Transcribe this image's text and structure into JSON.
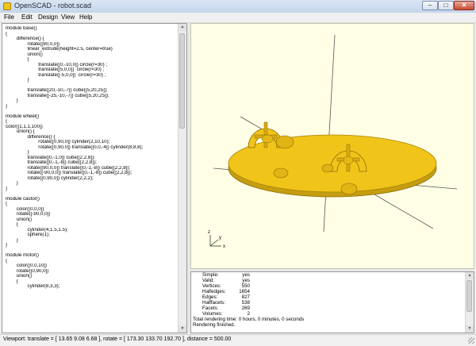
{
  "window": {
    "title": "OpenSCAD - robot.scad",
    "minimize_glyph": "–",
    "maximize_glyph": "□",
    "close_glyph": "✕"
  },
  "menu": [
    "File",
    "Edit",
    "Design",
    "View",
    "Help"
  ],
  "editor": {
    "lines": [
      "module base()",
      "{",
      "        difference() {",
      "                rotate([90,0,0])",
      "                linear_extrude(height=2.5, center=true)",
      "                union()",
      "                {",
      "                        translate([0,-10,0]) circle(r=30) ;",
      "                        translate([5,0,0])  circle(r=30) ;",
      "                        translate([-5,0,0])  circle(r=30) ;",
      "                }",
      "",
      "                translate([20,-10,-7]) cube([5,20,25]);",
      "                translate([-25,-10,-7]) cube([5,20,25]);",
      "        }",
      "}",
      "",
      "module wheel()",
      "{",
      "color([1,1,1,100])",
      "        union() {",
      "                difference() {",
      "                        rotate([0,90,0]) cylinder(2,10,10);",
      "                        rotate([0,90,0]) translate([0,0,-4]) cylinder(8,8,8);",
      "                }",
      "                translate([0,-1,0]) cube([2,2,8]);",
      "                translate([0,-1,-8]) cube([2,2,8]);",
      "                rotate([90,0,0]) translate([0,-1,-8]) cube([2,2,8]);",
      "                rotate([-90,0,0]) translate([0,-1,-8]) cube([2,2,8]);",
      "                rotate([0,90,0]) cylinder(2,2,2);",
      "        }",
      "}",
      "",
      "module castor()",
      "{",
      "        color([0,0,0])",
      "        rotate([-90,0,0])",
      "        union()",
      "        {",
      "                cylinder(4,1.5,1.5);",
      "                sphere(1);",
      "        }",
      "}",
      "",
      "module motor()",
      "{",
      "        color([0,0,10])",
      "        rotate([0,90,0])",
      "        union()",
      "        {",
      "                cylinder(8,3,3);"
    ]
  },
  "viewport": {
    "background": "#ffffe5",
    "model_color": "#f0c419",
    "model_outline": "#a8860c",
    "axes": [
      "x",
      "y",
      "z"
    ]
  },
  "console": {
    "rows": [
      {
        "key": "Simple:",
        "value": "yes"
      },
      {
        "key": "Valid:",
        "value": "yes"
      },
      {
        "key": "Vertices:",
        "value": "550"
      },
      {
        "key": "Halfedges:",
        "value": "1654"
      },
      {
        "key": "Edges:",
        "value": "827"
      },
      {
        "key": "Halffacets:",
        "value": "538"
      },
      {
        "key": "Facets:",
        "value": "269"
      },
      {
        "key": "Volumes:",
        "value": "2"
      }
    ],
    "total_time": "Total rendering time: 0 hours, 0 minutes, 0 seconds",
    "finished": "Rendering finished."
  },
  "status": {
    "text": "Viewport: translate = [ 13.65 9.08 6.68 ], rotate = [ 173.30 133.70 192.70 ], distance = 500.00"
  }
}
